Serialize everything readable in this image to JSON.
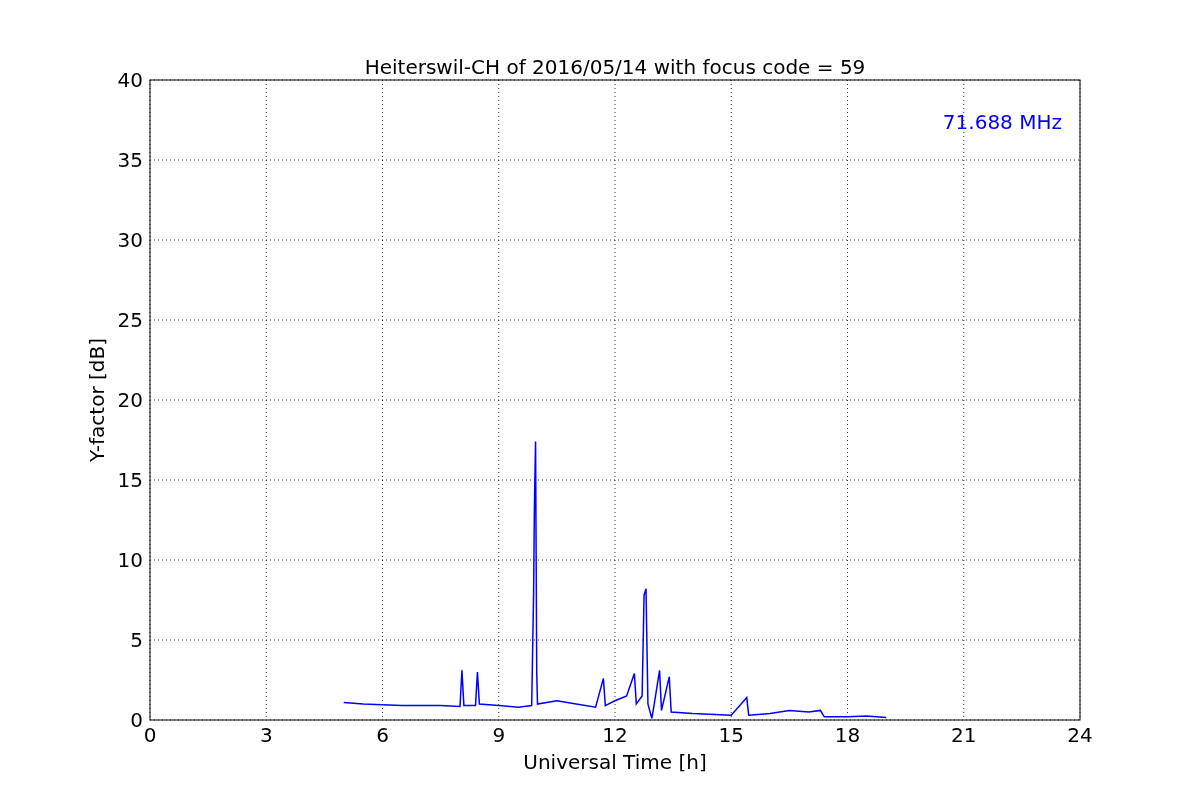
{
  "figure": {
    "chart_data": {
      "type": "line",
      "title": "Heiterswil-CH of 2016/05/14 with focus code = 59",
      "xlabel": "Universal Time [h]",
      "ylabel": "Y-factor [dB]",
      "xlim": [
        0,
        24
      ],
      "ylim": [
        0,
        40
      ],
      "xticks": [
        0,
        3,
        6,
        9,
        12,
        15,
        18,
        21,
        24
      ],
      "yticks": [
        0,
        5,
        10,
        15,
        20,
        25,
        30,
        35,
        40
      ],
      "x": [
        5.0,
        5.5,
        6,
        6.5,
        7,
        7.5,
        8.0,
        8.05,
        8.1,
        8.4,
        8.45,
        8.5,
        9,
        9.5,
        9.85,
        9.9,
        9.92,
        9.95,
        9.98,
        10.0,
        10.5,
        11,
        11.5,
        11.7,
        11.75,
        12,
        12.3,
        12.5,
        12.55,
        12.7,
        12.75,
        12.8,
        12.85,
        12.95,
        13.0,
        13.15,
        13.2,
        13.4,
        13.45,
        14,
        15,
        15.4,
        15.45,
        16,
        16.5,
        17,
        17.3,
        17.4,
        18,
        18.5,
        19
      ],
      "series": [
        {
          "name": "71.688 MHz",
          "color": "#0000ff",
          "values": [
            1.1,
            1.0,
            0.95,
            0.9,
            0.9,
            0.9,
            0.85,
            3.1,
            0.9,
            0.9,
            3.0,
            1.0,
            0.9,
            0.8,
            0.9,
            8.0,
            13.3,
            17.4,
            3.0,
            1.0,
            1.2,
            1.0,
            0.8,
            2.6,
            0.9,
            1.2,
            1.5,
            2.9,
            1.0,
            1.5,
            7.8,
            8.2,
            1.0,
            0.1,
            0.8,
            3.1,
            0.6,
            2.7,
            0.5,
            0.4,
            0.3,
            1.4,
            0.3,
            0.4,
            0.6,
            0.5,
            0.6,
            0.2,
            0.2,
            0.25,
            0.15
          ]
        }
      ],
      "grid": true
    }
  }
}
